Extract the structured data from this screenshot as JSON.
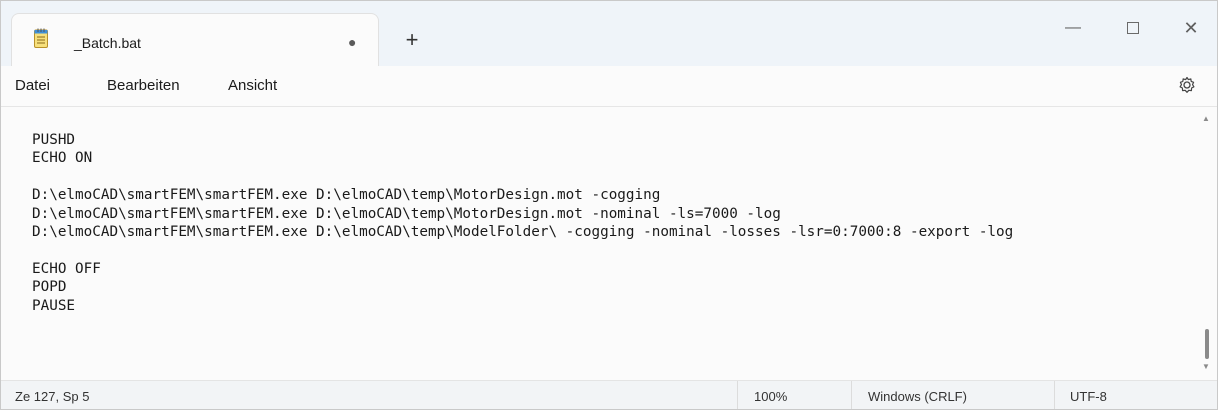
{
  "tab": {
    "title": "_Batch.bat",
    "modified_indicator": "●",
    "new_tab": "+"
  },
  "window_controls": {
    "minimize": "—",
    "maximize": "□",
    "close": "✕"
  },
  "menu": {
    "file": "Datei",
    "edit": "Bearbeiten",
    "view": "Ansicht"
  },
  "icons": {
    "app": "notepad-icon",
    "settings": "gear-icon"
  },
  "editor": {
    "content": "PUSHD\nECHO ON\n\nD:\\elmoCAD\\smartFEM\\smartFEM.exe D:\\elmoCAD\\temp\\MotorDesign.mot -cogging\nD:\\elmoCAD\\smartFEM\\smartFEM.exe D:\\elmoCAD\\temp\\MotorDesign.mot -nominal -ls=7000 -log\nD:\\elmoCAD\\smartFEM\\smartFEM.exe D:\\elmoCAD\\temp\\ModelFolder\\ -cogging -nominal -losses -lsr=0:7000:8 -export -log\n\nECHO OFF\nPOPD\nPAUSE"
  },
  "status": {
    "position": "Ze 127, Sp 5",
    "zoom": "100%",
    "line_ending": "Windows (CRLF)",
    "encoding": "UTF-8"
  },
  "colors": {
    "titlebar": "#eff4f9",
    "editor_bg": "#fbfbfb",
    "statusbar": "#f2f4f6"
  }
}
